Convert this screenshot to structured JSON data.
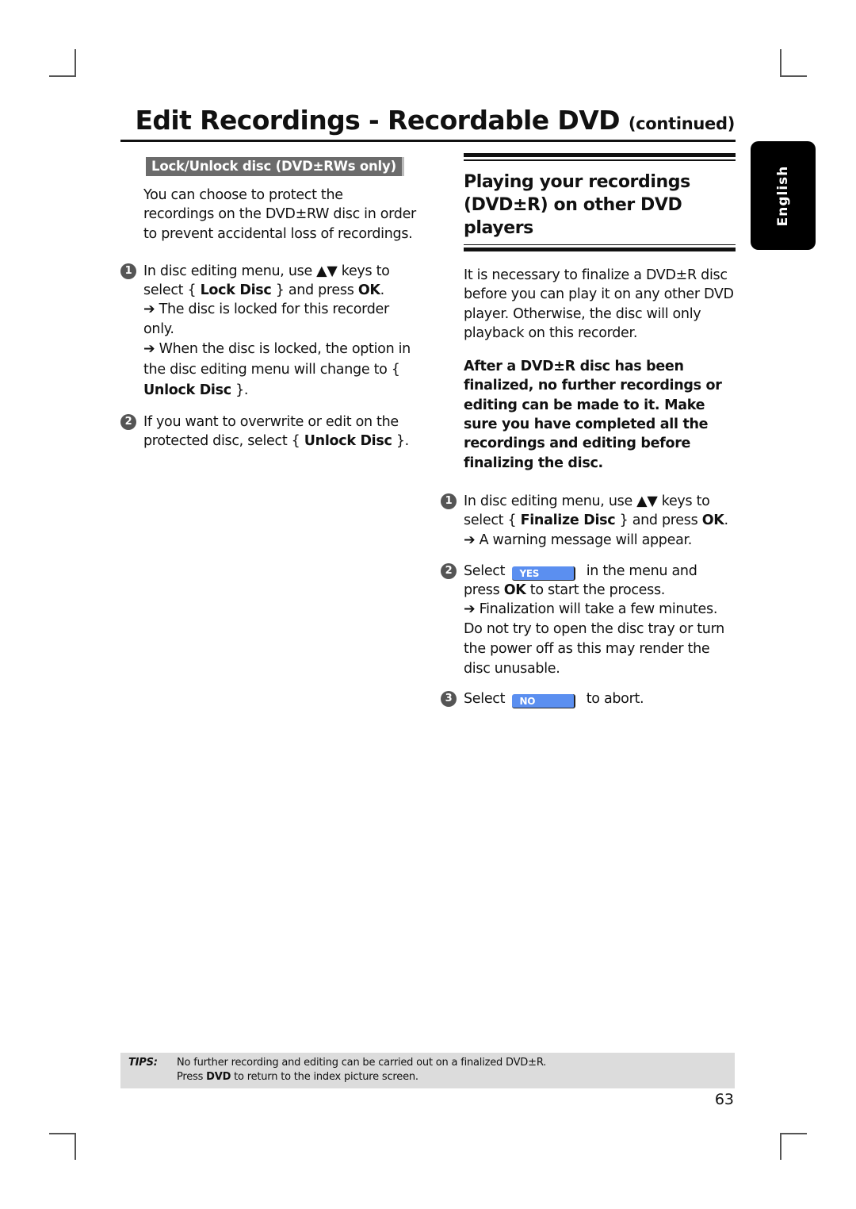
{
  "header": {
    "title": "Edit Recordings - Recordable DVD",
    "title_suffix": "(continued)"
  },
  "language_tab": "English",
  "left_column": {
    "section_title": "Lock/Unlock disc (DVD±RWs only)",
    "intro": "You can choose to protect the recordings on the DVD±RW disc in order to prevent accidental loss of recordings.",
    "steps": [
      {
        "number": "1",
        "pre": "In disc editing menu, use ▲▼ keys to select { ",
        "bold": "Lock Disc",
        "mid": " } and press ",
        "bold2": "OK",
        "post": ".",
        "result1": "➔ The disc is locked for this recorder only.",
        "result2_pre": "➔ When the disc is locked, the option in the disc editing menu will change to { ",
        "result2_bold": "Unlock Disc",
        "result2_post": " }."
      },
      {
        "number": "2",
        "pre": "If you want to overwrite or edit on the protected disc, select { ",
        "bold": "Unlock Disc",
        "post": " }."
      }
    ]
  },
  "right_column": {
    "section_title": "Playing your recordings (DVD±R) on other DVD players",
    "intro": "It is necessary to finalize a DVD±R disc before you can play it on any other DVD player. Otherwise, the disc will only playback on this recorder.",
    "warning": "After a DVD±R disc has been finalized, no further recordings or editing can be made to it. Make sure you have completed all the recordings and editing before finalizing the disc.",
    "steps": [
      {
        "number": "1",
        "pre": "In disc editing menu, use ▲▼ keys to select { ",
        "bold": "Finalize Disc",
        "mid": " } and press ",
        "bold2": "OK",
        "post": ".",
        "result": "➔ A warning message will appear."
      },
      {
        "number": "2",
        "pre": "Select",
        "badge": "YES",
        "post": "in the menu and press",
        "bold": "OK",
        "post2": " to start the process.",
        "result": "➔ Finalization will take a few minutes. Do not try to open the disc tray or turn the power off as this may render the disc unusable."
      },
      {
        "number": "3",
        "pre": "Select",
        "badge": "NO",
        "post": "to abort."
      }
    ]
  },
  "tips": {
    "label": "TIPS:",
    "line1": "No further recording and editing can be carried out on a finalized DVD±R.",
    "line2_pre": "Press ",
    "line2_bold": "DVD",
    "line2_post": " to return to the index picture screen."
  },
  "page_number": "63",
  "colors": {
    "section_bar": "#6b6b6b",
    "menu_badge": "#5b8ff0",
    "tips_bg": "#dcdcdc",
    "lang_tab": "#000000"
  }
}
